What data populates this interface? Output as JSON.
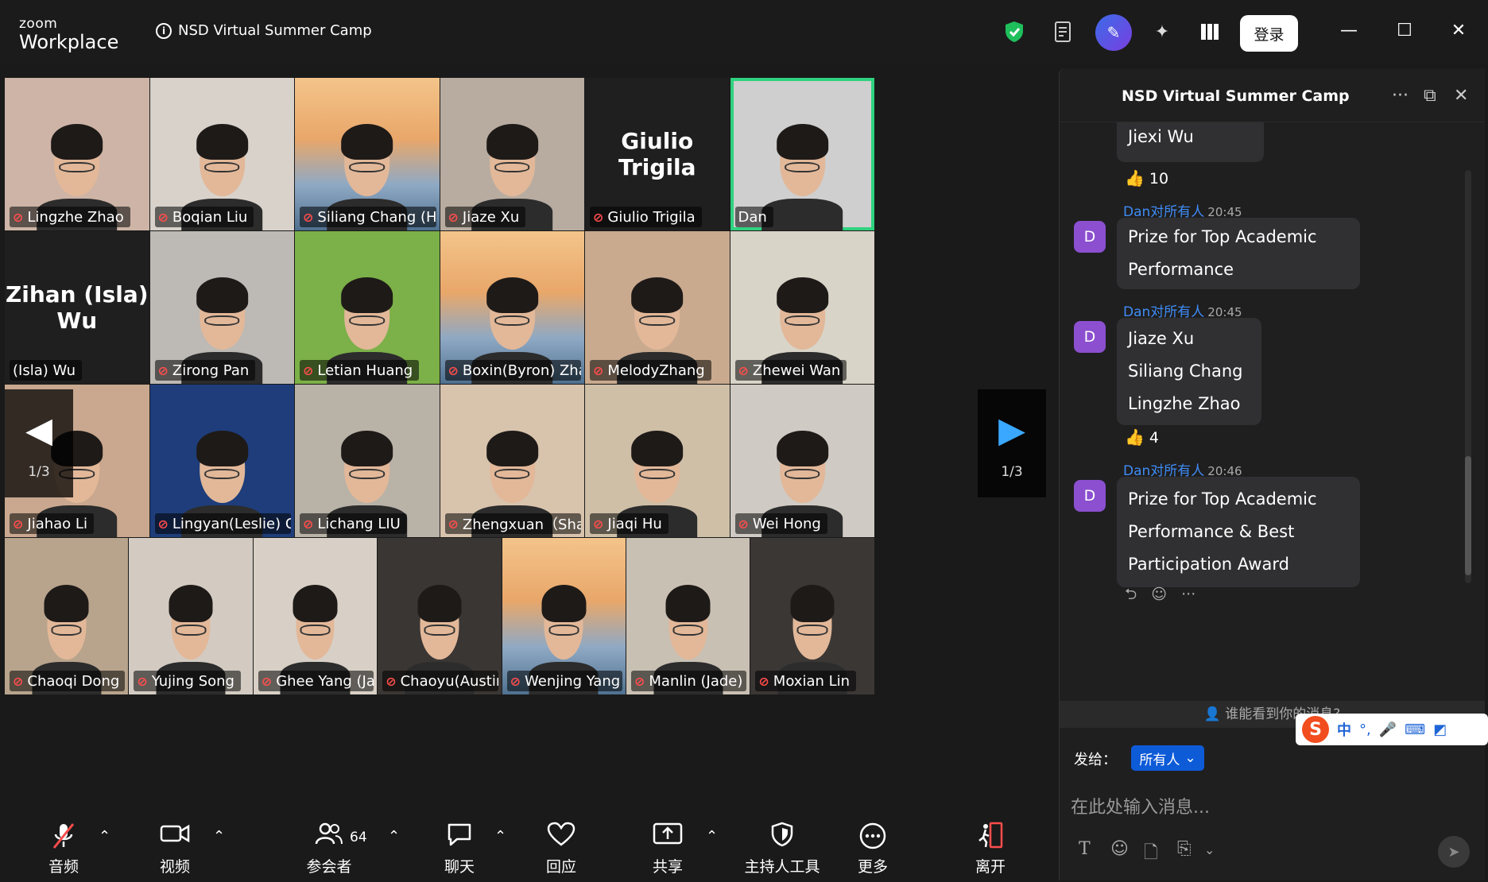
{
  "app": {
    "logo_top": "zoom",
    "logo_bottom": "Workplace",
    "meeting_title": "NSD Virtual Summer Camp",
    "login_label": "登录"
  },
  "icons": {
    "shield": "shield-check-icon",
    "notes": "notes-icon",
    "ai": "ai-sparkle-icon",
    "layout": "layout-icon",
    "minimize": "minimize-icon",
    "maximize": "maximize-icon",
    "close": "close-icon"
  },
  "grid": {
    "tiles": [
      {
        "name": "Lingzhe Zhao",
        "muted": true,
        "bg": "#cdb4a6"
      },
      {
        "name": "Boqian Liu",
        "muted": true,
        "bg": "#d8d2cb"
      },
      {
        "name": "Siliang Chang (He)",
        "muted": true,
        "bg": "#9fb6cf",
        "bridge": true
      },
      {
        "name": "Jiaze Xu",
        "muted": true,
        "bg": "#b8aca0"
      },
      {
        "name": "Giulio Trigila",
        "muted": true,
        "bg": "#1f1f1f",
        "big": "Giulio Trigila",
        "novideo": true
      },
      {
        "name": "Dan",
        "muted": false,
        "bg": "#cfcfcf",
        "active": true
      },
      {
        "name": "(Isla) Wu",
        "muted": false,
        "bg": "#1f1f1f",
        "big": "Zihan (Isla) Wu",
        "novideo": true
      },
      {
        "name": "Zirong Pan",
        "muted": true,
        "bg": "#bdb9b4"
      },
      {
        "name": "Letian Huang",
        "muted": true,
        "bg": "#7cb048"
      },
      {
        "name": "Boxin(Byron) Zhang",
        "muted": true,
        "bg": "#9fb6cf",
        "bridge": true
      },
      {
        "name": "MelodyZhang",
        "muted": true,
        "bg": "#c9aa8f"
      },
      {
        "name": "Zhewei Wan",
        "muted": true,
        "bg": "#d9d4c8"
      },
      {
        "name": "Jiahao Li",
        "muted": true,
        "bg": "#c9a88f"
      },
      {
        "name": "Lingyan(Leslie) Cui",
        "muted": true,
        "bg": "#1e3d7a"
      },
      {
        "name": "Lichang LIU",
        "muted": true,
        "bg": "#b9b2a7"
      },
      {
        "name": "Zhengxuan（Shaw...",
        "muted": true,
        "bg": "#d8c3ad"
      },
      {
        "name": "Jiaqi Hu",
        "muted": true,
        "bg": "#cfbfa7"
      },
      {
        "name": "Wei Hong",
        "muted": true,
        "bg": "#cfcac3"
      },
      {
        "name": "Chaoqi Dong",
        "muted": true,
        "bg": "#b8a48c"
      },
      {
        "name": "Yujing Song",
        "muted": true,
        "bg": "#d3cbc2"
      },
      {
        "name": "Ghee Yang (Jayd...",
        "muted": true,
        "bg": "#d8d0c6"
      },
      {
        "name": "Chaoyu(Austin)...",
        "muted": true,
        "bg": "#3a3634"
      },
      {
        "name": "Wenjing Yang",
        "muted": true,
        "bg": "#9fb6cf",
        "bridge": true
      },
      {
        "name": "Manlin (Jade) W...",
        "muted": true,
        "bg": "#c9c0b4"
      },
      {
        "name": "Moxian Lin",
        "muted": true,
        "bg": "#3b3735"
      }
    ],
    "page_left": "1/3",
    "page_right": "1/3"
  },
  "toolbar": {
    "audio": "音频",
    "video": "视频",
    "participants": "参会者",
    "participants_count": "64",
    "chat": "聊天",
    "react": "回应",
    "share": "共享",
    "host_tools": "主持人工具",
    "more": "更多",
    "leave": "离开"
  },
  "chat": {
    "title": "NSD Virtual Summer Camp",
    "messages": [
      {
        "text": "Jiexi  Wu"
      },
      {
        "reaction_count": "10"
      },
      {
        "sender": "Dan对所有人",
        "time": "20:45",
        "avatar": "D",
        "lines": [
          "Prize for Top Academic",
          "Performance"
        ]
      },
      {
        "sender": "Dan对所有人",
        "time": "20:45",
        "avatar": "D",
        "lines": [
          "Jiaze  Xu",
          "Siliang  Chang",
          "Lingzhe  Zhao"
        ]
      },
      {
        "reaction_count": "4"
      },
      {
        "sender": "Dan对所有人",
        "time": "20:46",
        "avatar": "D",
        "lines": [
          "Prize for Top Academic",
          "Performance & Best",
          "Participation Award"
        ]
      }
    ],
    "who_sees": "谁能看到你的消息?",
    "send_to_label": "发给：",
    "send_to_value": "所有人",
    "input_placeholder": "在此处输入消息..."
  },
  "ime": {
    "lang": "中"
  }
}
